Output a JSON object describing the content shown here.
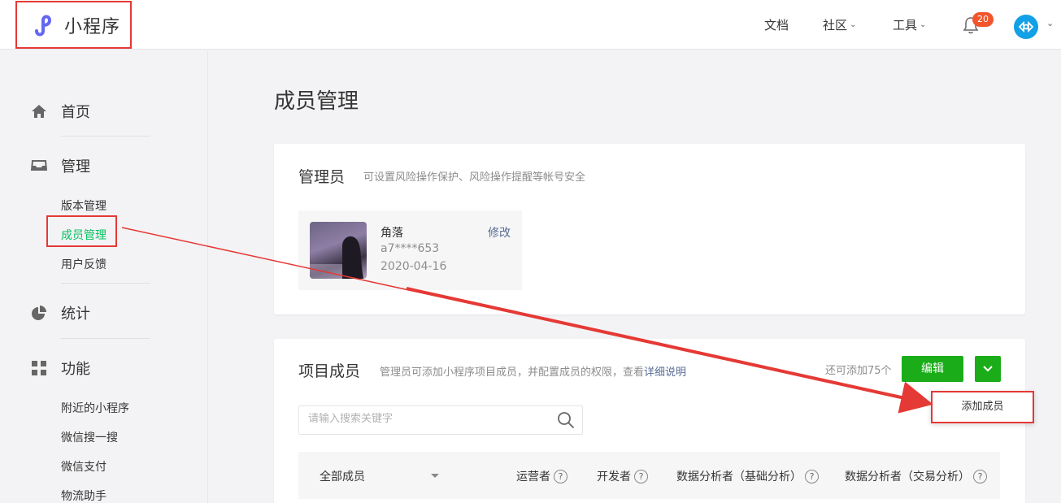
{
  "header": {
    "logo_text": "小程序",
    "nav": [
      {
        "label": "文档",
        "has_dropdown": false
      },
      {
        "label": "社区",
        "has_dropdown": true
      },
      {
        "label": "工具",
        "has_dropdown": true
      }
    ],
    "notification_count": "20",
    "chevron": "⌄"
  },
  "sidebar": {
    "home": "首页",
    "manage": "管理",
    "manage_items": [
      "版本管理",
      "成员管理",
      "用户反馈"
    ],
    "stats": "统计",
    "features": "功能",
    "feature_items": [
      "附近的小程序",
      "微信搜一搜",
      "微信支付",
      "物流助手"
    ]
  },
  "main": {
    "title": "成员管理",
    "admin": {
      "title": "管理员",
      "desc": "可设置风险操作保护、风险操作提醒等帐号安全",
      "name": "角落",
      "id": "a7****653",
      "date": "2020-04-16",
      "edit": "修改"
    },
    "members": {
      "title": "项目成员",
      "desc": "管理员可添加小程序项目成员，并配置成员的权限，查看",
      "desc_link": "详细说明",
      "remaining": "还可添加75个",
      "edit_button": "编辑",
      "dropdown_item": "添加成员",
      "search_placeholder": "请输入搜索关键字",
      "filter": "全部成员",
      "columns": [
        "运营者",
        "开发者",
        "数据分析者（基础分析）",
        "数据分析者（交易分析）"
      ],
      "help_mark": "?"
    }
  },
  "colors": {
    "accent_green": "#1aad19",
    "link_blue": "#576b95",
    "annotation_red": "#e53935",
    "active_green": "#07c160"
  }
}
